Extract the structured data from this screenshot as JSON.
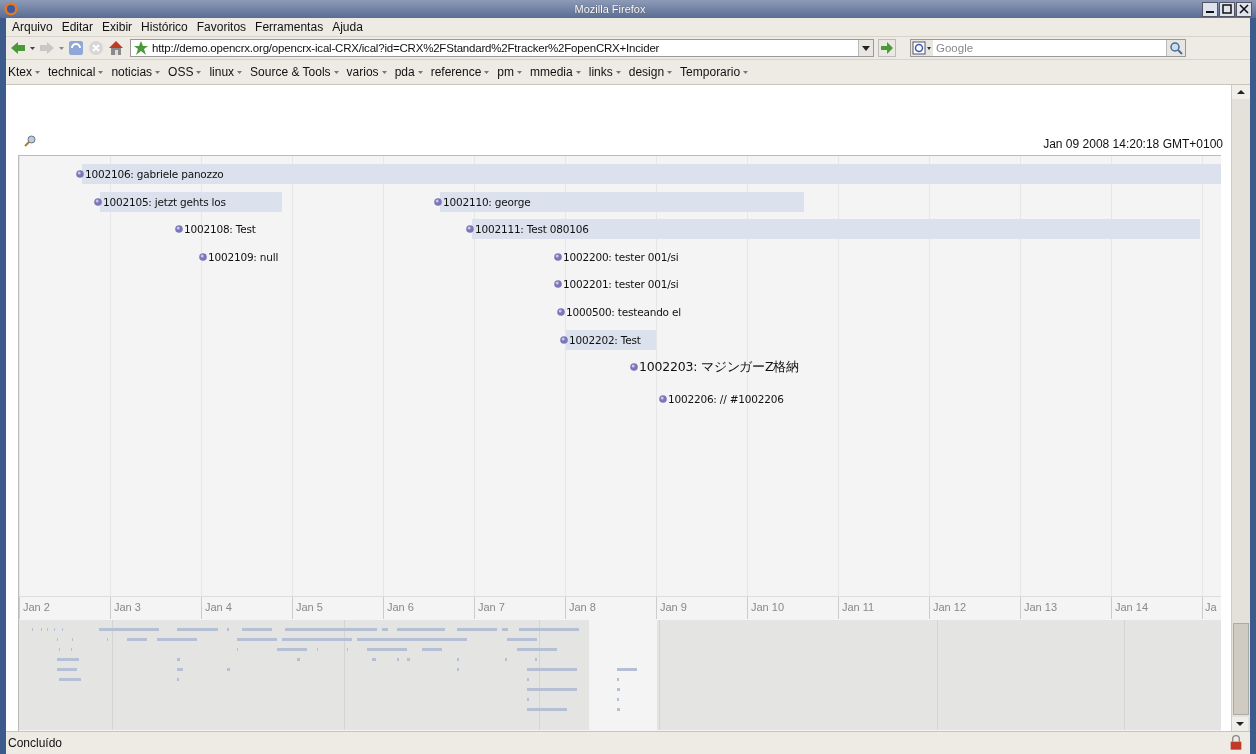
{
  "window": {
    "title": "Mozilla Firefox"
  },
  "menu": [
    "Arquivo",
    "Editar",
    "Exibir",
    "Histórico",
    "Favoritos",
    "Ferramentas",
    "Ajuda"
  ],
  "toolbar": {
    "url": "http://demo.opencrx.org/opencrx-ical-CRX/ical?id=CRX%2FStandard%2Ftracker%2FopenCRX+Incider",
    "search": {
      "placeholder": "Google"
    }
  },
  "bookmarks": [
    "Ktex",
    "technical",
    "noticias",
    "OSS",
    "linux",
    "Source & Tools",
    "varios",
    "pda",
    "reference",
    "pm",
    "mmedia",
    "links",
    "design",
    "Temporario"
  ],
  "timeline": {
    "timestamp": "Jan 09 2008 14:20:18 GMT+0100",
    "events": [
      {
        "label": "1002106: gabriele panozzo"
      },
      {
        "label": "1002105: jetzt gehts los"
      },
      {
        "label": "1002110: george"
      },
      {
        "label": "1002108: Test"
      },
      {
        "label": "1002111: Test 080106"
      },
      {
        "label": "1002109: null"
      },
      {
        "label": "1002200: tester 001/si"
      },
      {
        "label": "1002201: tester 001/si"
      },
      {
        "label": "1000500: testeando el"
      },
      {
        "label": "1002202: Test"
      },
      {
        "label": "1002203: マジンガーZ格納"
      },
      {
        "label": "1002206: // #1002206"
      }
    ],
    "dates": [
      "Jan 2",
      "Jan 3",
      "Jan 4",
      "Jan 5",
      "Jan 6",
      "Jan 7",
      "Jan 8",
      "Jan 9",
      "Jan 10",
      "Jan 11",
      "Jan 12",
      "Jan 13",
      "Jan 14",
      "Ja"
    ]
  },
  "status_bar": {
    "text": "Concluído"
  }
}
